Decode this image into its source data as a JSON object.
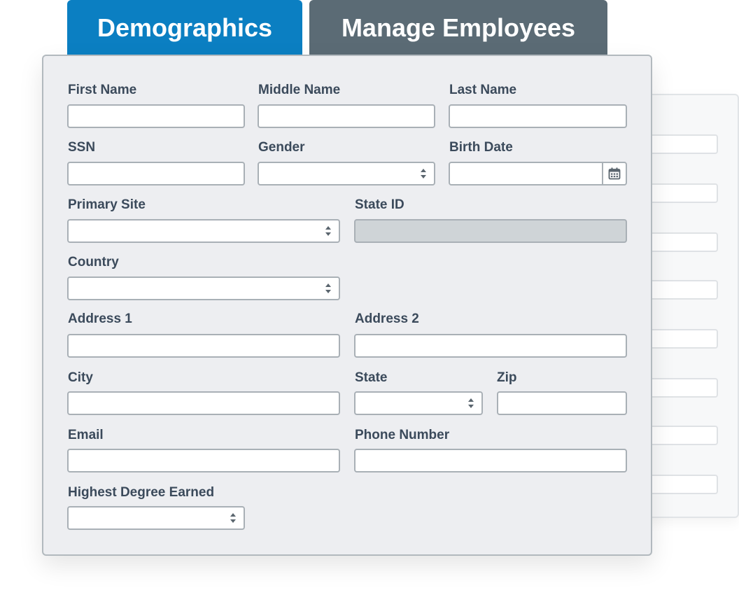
{
  "tabs": {
    "demographics": "Demographics",
    "manage_employees": "Manage Employees"
  },
  "form": {
    "first_name": {
      "label": "First Name",
      "value": ""
    },
    "middle_name": {
      "label": "Middle Name",
      "value": ""
    },
    "last_name": {
      "label": "Last Name",
      "value": ""
    },
    "ssn": {
      "label": "SSN",
      "value": ""
    },
    "gender": {
      "label": "Gender",
      "value": ""
    },
    "birth_date": {
      "label": "Birth Date",
      "value": ""
    },
    "primary_site": {
      "label": "Primary Site",
      "value": ""
    },
    "state_id": {
      "label": "State ID",
      "value": ""
    },
    "country": {
      "label": "Country",
      "value": ""
    },
    "address1": {
      "label": "Address 1",
      "value": ""
    },
    "address2": {
      "label": "Address 2",
      "value": ""
    },
    "city": {
      "label": "City",
      "value": ""
    },
    "state": {
      "label": "State",
      "value": ""
    },
    "zip": {
      "label": "Zip",
      "value": ""
    },
    "email": {
      "label": "Email",
      "value": ""
    },
    "phone": {
      "label": "Phone Number",
      "value": ""
    },
    "degree": {
      "label": "Highest Degree Earned",
      "value": ""
    }
  },
  "icons": {
    "select": "select-arrows-icon",
    "calendar": "calendar-icon"
  },
  "colors": {
    "tab_active": "#0b7fc2",
    "tab_inactive": "#5b6b75",
    "panel_bg": "#edeef1",
    "label": "#3b4a5b"
  }
}
